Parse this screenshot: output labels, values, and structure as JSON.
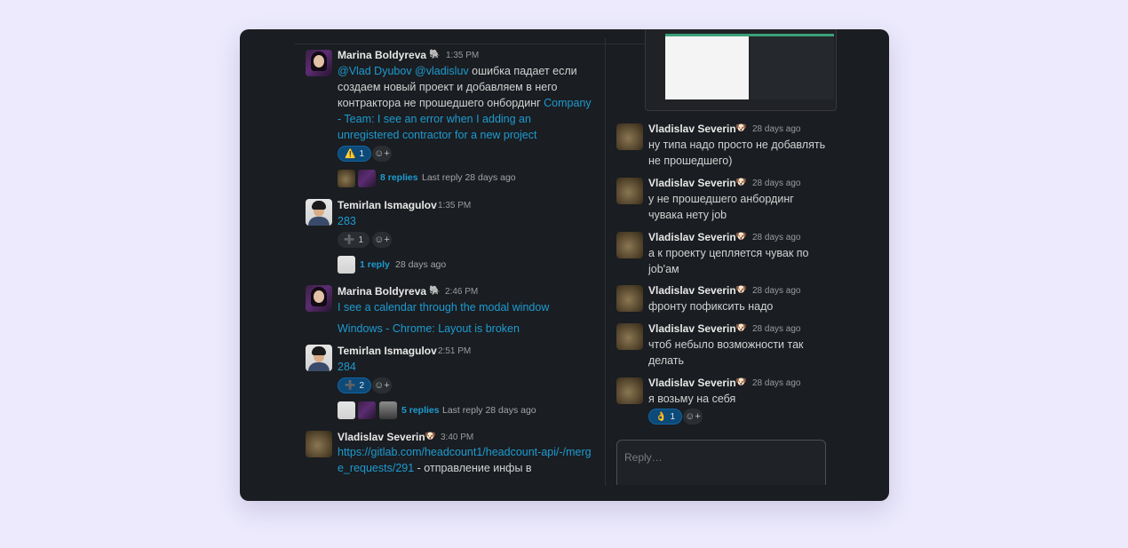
{
  "left": {
    "m1": {
      "name": "Marina Boldyreva",
      "badge": "🐘",
      "time": "1:35 PM",
      "mention": "@Vlad Dyubov  @vladisluv",
      "text1": " ошибка падает если создаем новый проект и добавляем в него контрактора не прошедшего онбординг ",
      "link": "Company - Team: I see an error when I adding an unregistered contractor for a new project",
      "reaction_emoji": "⚠️",
      "reaction_count": "1",
      "add_reaction": "☺+",
      "replies": "8 replies",
      "last_reply": "Last reply 28 days ago"
    },
    "m2": {
      "name": "Temirlan Ismagulov",
      "time": "1:35 PM",
      "link": "283",
      "reaction_emoji": "➕",
      "reaction_count": "1",
      "add_reaction": "☺+",
      "replies": "1 reply",
      "last_reply": "28 days ago"
    },
    "m3": {
      "name": "Marina Boldyreva",
      "badge": "🐘",
      "time": "2:46 PM",
      "link1": "I see a calendar through the modal window",
      "link2": "Windows - Chrome: Layout is broken"
    },
    "m4": {
      "name": "Temirlan Ismagulov",
      "time": "2:51 PM",
      "link": "284",
      "reaction_emoji": "➕",
      "reaction_count": "2",
      "add_reaction": "☺+",
      "replies": "5 replies",
      "last_reply": "Last reply 28 days ago"
    },
    "m5": {
      "name": "Vladislav Severin",
      "badge": "🐶",
      "time": "3:40 PM",
      "link": "https://gitlab.com/headcount1/headcount-api/-/merge_requests/291",
      "text": " - отправление инфы в"
    }
  },
  "right": {
    "messages": [
      {
        "name": "Vladislav Severin",
        "badge": "🐶",
        "time": "28 days ago",
        "text": "ну типа надо просто не добавлять не прошедшего)"
      },
      {
        "name": "Vladislav Severin",
        "badge": "🐶",
        "time": "28 days ago",
        "text": "у не прошедшего анбординг чувака нету job"
      },
      {
        "name": "Vladislav Severin",
        "badge": "🐶",
        "time": "28 days ago",
        "text": "а к проекту цепляется чувак по job'ам"
      },
      {
        "name": "Vladislav Severin",
        "badge": "🐶",
        "time": "28 days ago",
        "text": "фронту пофиксить надо"
      },
      {
        "name": "Vladislav Severin",
        "badge": "🐶",
        "time": "28 days ago",
        "text": "чтоб небыло возможности так делать"
      },
      {
        "name": "Vladislav Severin",
        "badge": "🐶",
        "time": "28 days ago",
        "text": "я возьму на себя"
      }
    ],
    "last_reaction_emoji": "👌",
    "last_reaction_count": "1",
    "add_reaction": "☺+",
    "reply_placeholder": "Reply…"
  },
  "colors": {
    "background": "#eceafc",
    "panel": "#1a1d21",
    "link": "#1d9bd1",
    "reaction_active": "#0d4a78"
  }
}
